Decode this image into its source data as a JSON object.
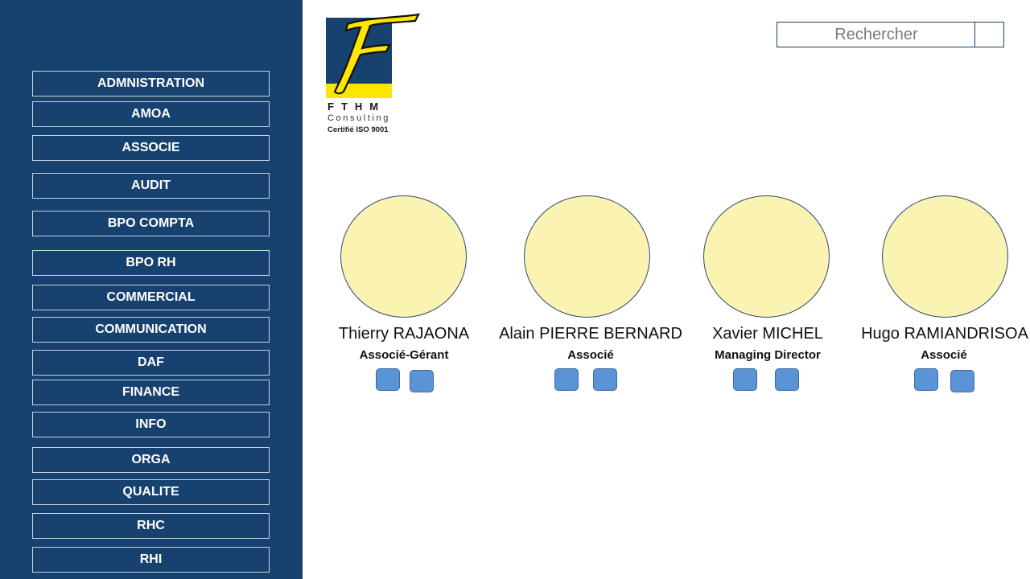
{
  "sidebar": {
    "items": [
      {
        "label": "ADMNISTRATION"
      },
      {
        "label": "AMOA"
      },
      {
        "label": "ASSOCIE"
      },
      {
        "label": "AUDIT"
      },
      {
        "label": "BPO COMPTA"
      },
      {
        "label": "BPO RH"
      },
      {
        "label": "COMMERCIAL"
      },
      {
        "label": "COMMUNICATION"
      },
      {
        "label": "DAF"
      },
      {
        "label": "FINANCE"
      },
      {
        "label": "INFO"
      },
      {
        "label": "ORGA"
      },
      {
        "label": "QUALITE"
      },
      {
        "label": "RHC"
      },
      {
        "label": "RHI"
      }
    ]
  },
  "logo": {
    "letter": "F",
    "line1": "FTHM",
    "line2": "Consulting",
    "line3": "Certifié ISO 9001"
  },
  "search": {
    "placeholder": "Rechercher"
  },
  "people": [
    {
      "name": "Thierry RAJAONA",
      "role": "Associé-Gérant"
    },
    {
      "name": "Alain PIERRE BERNARD",
      "role": "Associé"
    },
    {
      "name": "Xavier MICHEL",
      "role": "Managing Director"
    },
    {
      "name": "Hugo RAMIANDRISOA",
      "role": "Associé"
    }
  ],
  "colors": {
    "sidebar_bg": "#17416e",
    "avatar_fill": "#fbf3b2",
    "action_button": "#5b94d6",
    "logo_yellow": "#ffe500"
  }
}
